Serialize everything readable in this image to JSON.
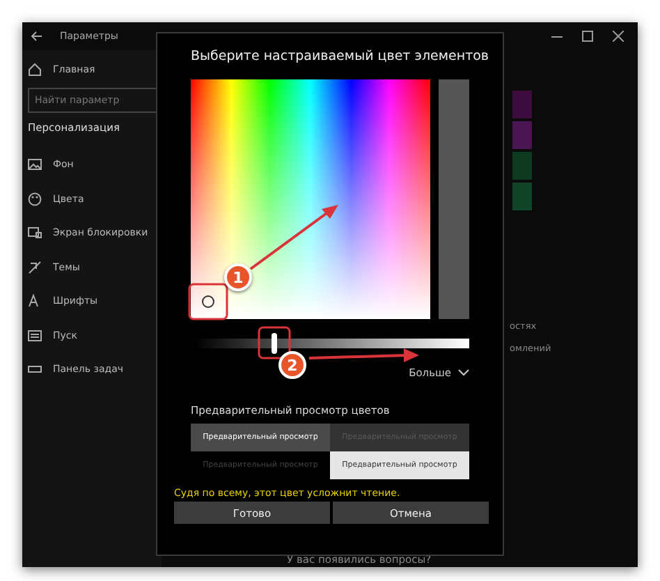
{
  "window": {
    "title": "Параметры"
  },
  "sidebar": {
    "home": "Главная",
    "search": {
      "placeholder": "Найти параметр"
    },
    "section": "Персонализация",
    "items": [
      {
        "label": "Фон"
      },
      {
        "label": "Цвета"
      },
      {
        "label": "Экран блокировки"
      },
      {
        "label": "Темы"
      },
      {
        "label": "Шрифты"
      },
      {
        "label": "Пуск"
      },
      {
        "label": "Панель задач"
      }
    ]
  },
  "background": {
    "swatches": [
      {
        "color": "#3d0c3f"
      },
      {
        "color": "#4a1550"
      },
      {
        "color": "#0f3a22"
      },
      {
        "color": "#12442a"
      }
    ],
    "texts": [
      "остях",
      "омлений"
    ],
    "footer": "У вас появились вопросы?"
  },
  "dialog": {
    "title": "Выберите настраиваемый цвет элементов",
    "brightness": {
      "level": 0.29
    },
    "more": "Больше",
    "preview_title": "Предварительный просмотр цветов",
    "preview": [
      {
        "label": "Предварительный просмотр",
        "kind": "dark"
      },
      {
        "label": "Предварительный просмотр",
        "kind": "dim-dark"
      },
      {
        "label": "Предварительный просмотр",
        "kind": "dim-black"
      },
      {
        "label": "Предварительный просмотр",
        "kind": "light"
      }
    ],
    "warning": "Судя по всему, этот цвет усложнит чтение.",
    "buttons": [
      "Готово",
      "Отмена"
    ]
  },
  "annotations": [
    {
      "label": "1"
    },
    {
      "label": "2"
    }
  ]
}
